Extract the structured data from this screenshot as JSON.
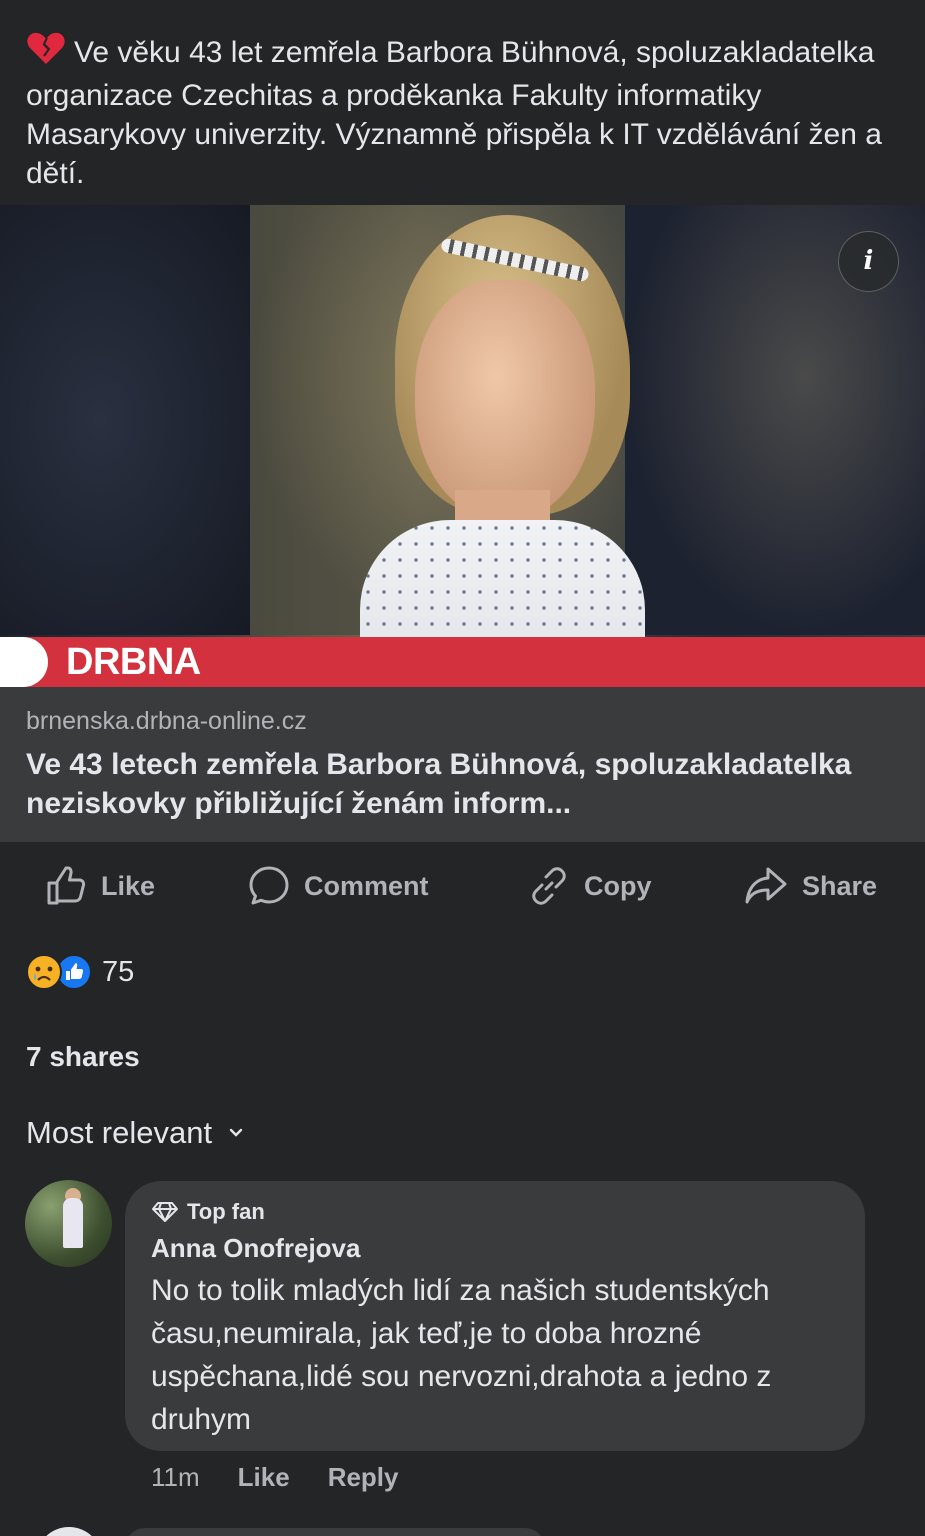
{
  "post": {
    "text": "Ve věku 43 let zemřela Barbora Bühnová, spoluzakladatelka organizace Czechitas a proděkanka Fakulty informatiky Masarykovy univerzity. Významně přispěla k IT vzdělávání žen a dětí.",
    "emoji_icon": "broken-heart-icon"
  },
  "link_preview": {
    "banner_brand": "DRBNA",
    "domain": "brnenska.drbna-online.cz",
    "headline": "Ve 43 letech zemřela Barbora Bühnová, spoluzakladatelka neziskovky přibližující ženám inform..."
  },
  "actions": [
    {
      "label": "Like",
      "icon": "thumbs-up-icon"
    },
    {
      "label": "Comment",
      "icon": "comment-icon"
    },
    {
      "label": "Copy",
      "icon": "link-icon"
    },
    {
      "label": "Share",
      "icon": "share-icon"
    }
  ],
  "reactions": {
    "count": "75",
    "types": [
      "sad",
      "like"
    ]
  },
  "shares": "7 shares",
  "sort": {
    "label": "Most relevant"
  },
  "comment": {
    "badge": "Top fan",
    "author": "Anna Onofrejova",
    "text": "No to tolik mladých lidí za našich studentských času,neumirala, jak teď,je to doba hrozné uspěchana,lidé sou nervozni,drahota a jedno z druhym",
    "time": "11m",
    "like_label": "Like",
    "reply_label": "Reply"
  },
  "colors": {
    "background": "#242526",
    "card": "#3a3b3c",
    "text": "#e4e6eb",
    "muted": "#b0b3b8",
    "banner_red": "#d4313f",
    "like_blue": "#1877f2"
  }
}
